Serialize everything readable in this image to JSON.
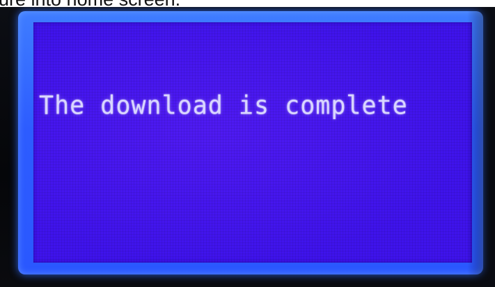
{
  "caption": {
    "text": "ure into home screen."
  },
  "lcd": {
    "message": "The download is complete",
    "backlight_color": "#2d5cff",
    "screen_color": "#3f13ec",
    "text_color": "#d9d6ff"
  }
}
